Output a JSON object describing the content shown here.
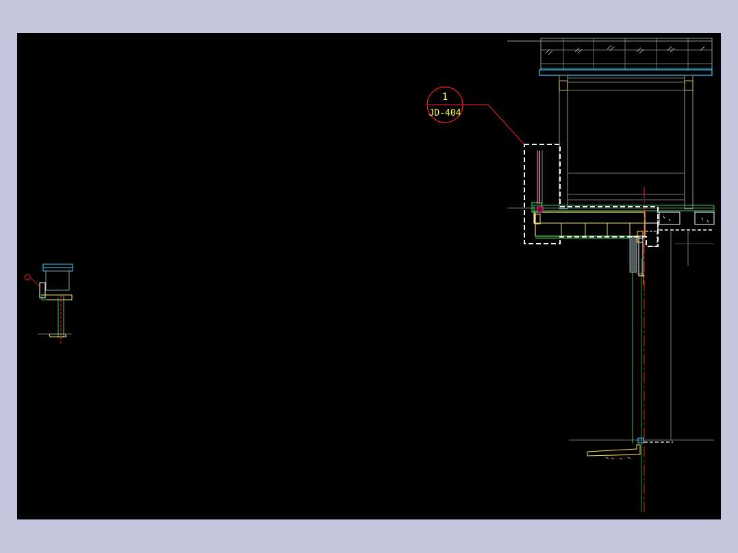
{
  "colors": {
    "chrome": "#c5c6dd",
    "canvas": "#000000",
    "callout": "#ff2020",
    "callout_text": "#ffff40",
    "line_green": "#30d050",
    "line_white": "#ffffff",
    "line_yellow": "#ffe060",
    "line_cyan": "#40d0ff",
    "line_dim": "#8aa0a0"
  },
  "callout": {
    "number": "1",
    "sheet": "JD-404"
  }
}
